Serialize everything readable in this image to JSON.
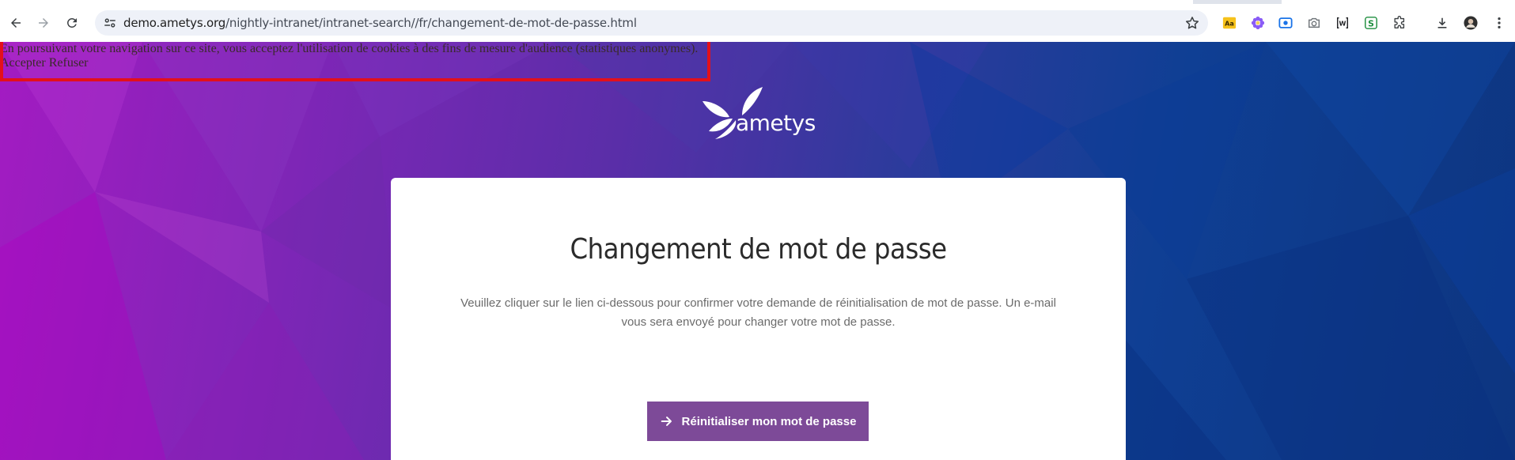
{
  "browser": {
    "url_host": "demo.ametys.org",
    "url_path": "/nightly-intranet/intranet-search//fr/changement-de-mot-de-passe.html",
    "extensions": [
      "dictionary-icon",
      "flower-icon",
      "screen-capture-icon",
      "camera-icon",
      "brackets-w-icon",
      "s-extension-icon",
      "puzzle-icon"
    ]
  },
  "cookie_banner": {
    "message": "En poursuivant votre navigation sur ce site, vous acceptez l'utilisation de cookies à des fins de mesure d'audience (statistiques anonymes).",
    "accept_label": "Accepter",
    "refuse_label": "Refuser"
  },
  "logo": {
    "text": "ametys"
  },
  "card": {
    "title": "Changement de mot de passe",
    "description": "Veuillez cliquer sur le lien ci-dessous pour confirmer votre demande de réinitialisation de mot de passe. Un e-mail vous sera envoyé pour changer votre mot de passe.",
    "button_label": "Réinitialiser mon mot de passe"
  },
  "colors": {
    "button_bg": "#7d4a98",
    "highlight_border": "#e3101b",
    "bg_left": "#a31bc2",
    "bg_right": "#0d3580"
  }
}
